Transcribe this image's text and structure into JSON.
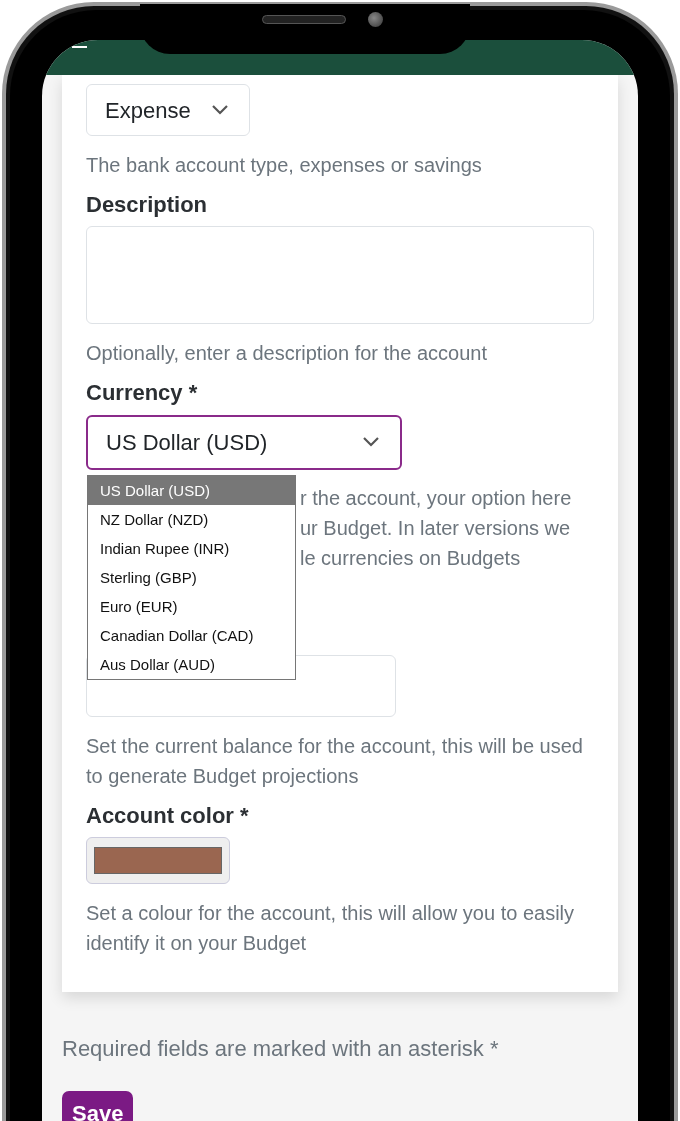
{
  "fields": [
    {
      "kind": "select",
      "value": "Expense",
      "focused": false,
      "helper": "The bank account type, expenses or savings"
    },
    {
      "kind": "textarea",
      "label": "Description",
      "helper": "Optionally, enter a description for the account"
    },
    {
      "kind": "select",
      "label": "Currency *",
      "value": "US Dollar (USD)",
      "focused": true,
      "open": true,
      "options": [
        {
          "label": "US Dollar (USD)",
          "selected": true
        },
        {
          "label": "NZ Dollar (NZD)",
          "selected": false
        },
        {
          "label": "Indian Rupee (INR)",
          "selected": false
        },
        {
          "label": "Sterling (GBP)",
          "selected": false
        },
        {
          "label": "Euro (EUR)",
          "selected": false
        },
        {
          "label": "Canadian Dollar (CAD)",
          "selected": false
        },
        {
          "label": "Aus Dollar (AUD)",
          "selected": false
        }
      ],
      "helper_lines": [
        "r the account, your option here",
        "ur Budget. In later versions we",
        "le currencies on Budgets"
      ]
    },
    {
      "kind": "input",
      "helper": "Set the current balance for the account, this will be used to generate Budget projections"
    },
    {
      "kind": "color",
      "label": "Account color *",
      "color": "#9a6650",
      "helper": "Set a colour for the account, this will allow you to easily identify it on your Budget"
    }
  ],
  "note": "Required fields are marked with an asterisk *",
  "buttons": [
    {
      "label": "Save"
    }
  ]
}
